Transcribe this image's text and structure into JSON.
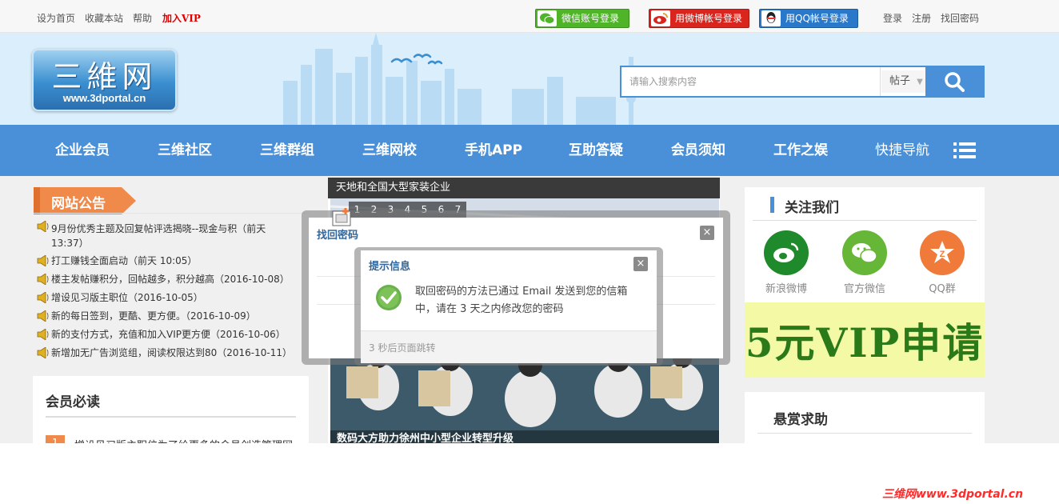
{
  "topbar": {
    "links": [
      "设为首页",
      "收藏本站",
      "帮助"
    ],
    "vip_link": "加入VIP",
    "wechat_login": "微信账号登录",
    "weibo_login": "用微博帐号登录",
    "qq_login": "用QQ帐号登录",
    "right_links": [
      "登录",
      "注册",
      "找回密码"
    ]
  },
  "logo": {
    "text": "三維网",
    "url": "www.3dportal.cn"
  },
  "search": {
    "placeholder": "请输入搜索内容",
    "scope": "帖子",
    "accent": "#4a90d9"
  },
  "nav": {
    "items": [
      "企业会员",
      "三维社区",
      "三维群组",
      "三维网校",
      "手机APP",
      "互助答疑",
      "会员须知",
      "工作之娱"
    ],
    "quick": "快捷导航"
  },
  "notice": {
    "title": "网站公告",
    "items": [
      "9月份优秀主题及回复帖评选揭晓--现金与积（前天 13:37）",
      "打工赚钱全面启动（前天 10:05）",
      "楼主发帖赚积分，回帖越多，积分越高（2016-10-08）",
      "增设见习版主职位（2016-10-05）",
      "新的每日签到，更酷、更方便。（2016-10-09）",
      "新的支付方式，充值和加入VIP更方便（2016-10-06）",
      "新增加无广告浏览组，阅读权限达到80（2016-10-11）"
    ]
  },
  "must_read": {
    "title": "会员必读",
    "first_num": "1",
    "first_text": "增设见习版主职位为了给更多的会员创造管理网"
  },
  "slideshow": {
    "caption": "天地和全国大型家装企业",
    "pages": [
      "1",
      "2",
      "3",
      "4",
      "5",
      "6",
      "7"
    ],
    "bottom_caption": "数码大方助力徐州中小型企业转型升级"
  },
  "follow": {
    "title": "关注我们",
    "items": [
      {
        "label": "新浪微博",
        "icon": "weibo-icon",
        "color": "#1f8a2c"
      },
      {
        "label": "官方微信",
        "icon": "wechat-icon",
        "color": "#66b637"
      },
      {
        "label": "QQ群",
        "icon": "qq-group-icon",
        "color": "#f07a3a"
      }
    ]
  },
  "vip_banner": "5元VIP申请",
  "reward": {
    "title": "悬赏求助"
  },
  "dialog_find": {
    "title": "找回密码",
    "close": "×"
  },
  "dialog_notice": {
    "title": "提示信息",
    "close": "×",
    "message": "取回密码的方法已通过 Email 发送到您的信箱中，请在 3 天之内修改您的密码",
    "footer": "3 秒后页面跳转"
  },
  "watermark": "三维网www.3dportal.cn"
}
